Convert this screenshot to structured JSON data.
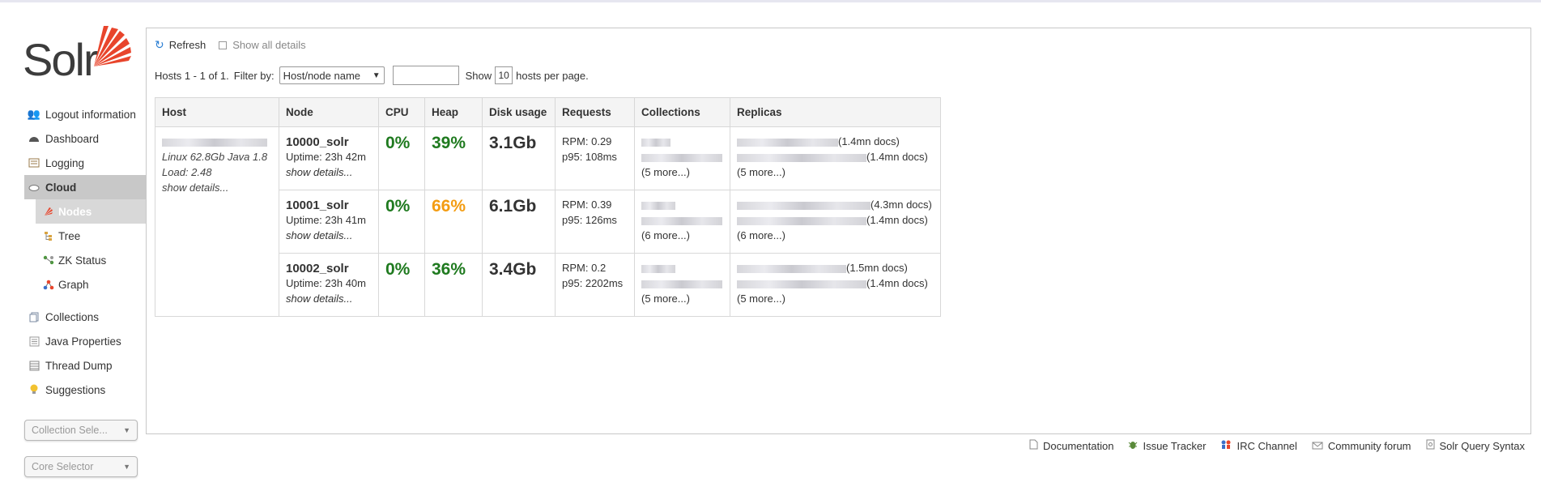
{
  "app": {
    "logo_text": "Solr"
  },
  "sidebar": {
    "items": [
      {
        "label": "Logout information",
        "icon": "user-icon"
      },
      {
        "label": "Dashboard",
        "icon": "dashboard-icon"
      },
      {
        "label": "Logging",
        "icon": "logging-icon"
      },
      {
        "label": "Cloud",
        "icon": "cloud-icon"
      }
    ],
    "cloud_sub": [
      {
        "label": "Nodes",
        "icon": "nodes-icon"
      },
      {
        "label": "Tree",
        "icon": "tree-icon"
      },
      {
        "label": "ZK Status",
        "icon": "zk-status-icon"
      },
      {
        "label": "Graph",
        "icon": "graph-icon"
      }
    ],
    "items2": [
      {
        "label": "Collections",
        "icon": "collections-icon"
      },
      {
        "label": "Java Properties",
        "icon": "java-icon"
      },
      {
        "label": "Thread Dump",
        "icon": "thread-dump-icon"
      },
      {
        "label": "Suggestions",
        "icon": "lightbulb-icon"
      }
    ],
    "collection_selector": "Collection Sele...",
    "core_selector": "Core Selector"
  },
  "toolbar": {
    "refresh_label": "Refresh",
    "show_all_label": "Show all details"
  },
  "filter": {
    "summary": "Hosts 1 - 1 of 1.",
    "filter_by_label": "Filter by:",
    "filter_value": "Host/node name",
    "show_label": "Show",
    "per_page": "10",
    "per_page_suffix": "hosts per page."
  },
  "table": {
    "headers": [
      "Host",
      "Node",
      "CPU",
      "Heap",
      "Disk usage",
      "Requests",
      "Collections",
      "Replicas"
    ],
    "host": {
      "os_line": "Linux 62.8Gb Java 1.8",
      "load": "Load: 2.48",
      "details": "show details..."
    },
    "nodes": [
      {
        "name": "10000_solr",
        "uptime": "Uptime: 23h 42m",
        "details": "show details...",
        "cpu": "0%",
        "heap": "39%",
        "disk": "3.1Gb",
        "rpm": "RPM: 0.29",
        "p95": "p95: 108ms",
        "coll_more": "(5 more...)",
        "replica1_docs": "(1.4mn docs)",
        "replica2_docs": "(1.4mn docs)",
        "replica_more": "(5 more...)"
      },
      {
        "name": "10001_solr",
        "uptime": "Uptime: 23h 41m",
        "details": "show details...",
        "cpu": "0%",
        "heap": "66%",
        "disk": "6.1Gb",
        "rpm": "RPM: 0.39",
        "p95": "p95: 126ms",
        "coll_more": "(6 more...)",
        "replica1_docs": "(4.3mn docs)",
        "replica2_docs": "(1.4mn docs)",
        "replica_more": "(6 more...)"
      },
      {
        "name": "10002_solr",
        "uptime": "Uptime: 23h 40m",
        "details": "show details...",
        "cpu": "0%",
        "heap": "36%",
        "disk": "3.4Gb",
        "rpm": "RPM: 0.2",
        "p95": "p95: 2202ms",
        "coll_more": "(5 more...)",
        "replica1_docs": "(1.5mn docs)",
        "replica2_docs": "(1.4mn docs)",
        "replica_more": "(5 more...)"
      }
    ]
  },
  "footer": [
    {
      "label": "Documentation",
      "icon": "document-icon"
    },
    {
      "label": "Issue Tracker",
      "icon": "bug-icon"
    },
    {
      "label": "IRC Channel",
      "icon": "irc-icon"
    },
    {
      "label": "Community forum",
      "icon": "mail-icon"
    },
    {
      "label": "Solr Query Syntax",
      "icon": "query-syntax-icon"
    }
  ],
  "colors": {
    "heap_ok": "#1f7a1f",
    "heap_warn": "#f39c12",
    "logo_orange": "#e8452c",
    "accent_blue": "#2a7ed3"
  }
}
